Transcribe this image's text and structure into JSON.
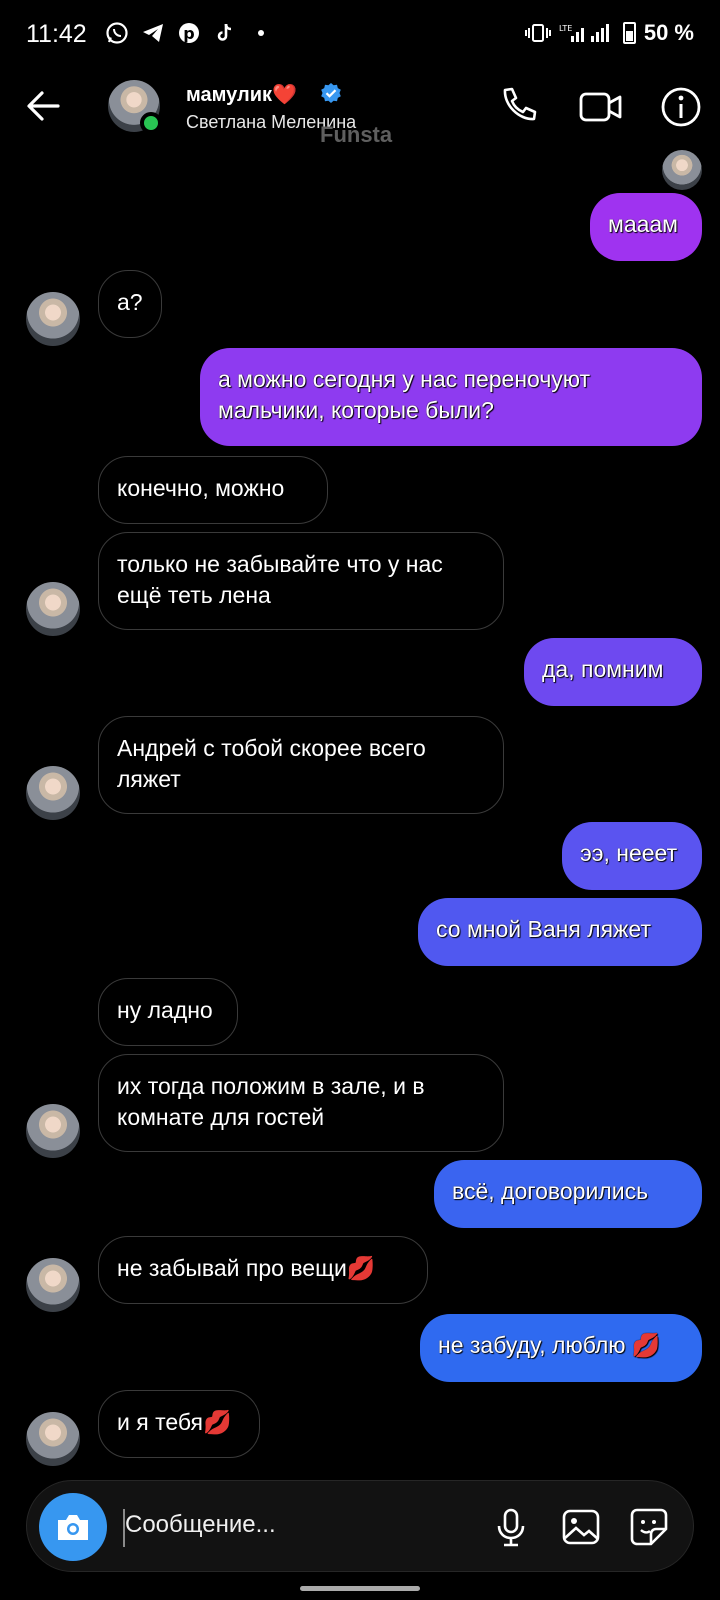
{
  "status_bar": {
    "time": "11:42",
    "battery": "50 %",
    "network": "LTE"
  },
  "header": {
    "contact_name": "мамулик❤️",
    "contact_subtitle": "Светлана Меленина",
    "watermark": "Funsta"
  },
  "messages": [
    {
      "dir": "out",
      "text": "мааам"
    },
    {
      "dir": "in",
      "text": "а?"
    },
    {
      "dir": "out",
      "text": "а можно сегодня у нас переночуют\nмальчики, которые  были?"
    },
    {
      "dir": "in",
      "text": "конечно, можно"
    },
    {
      "dir": "in",
      "text": "только не забывайте что у нас\nещё теть лена"
    },
    {
      "dir": "out",
      "text": "да, помним"
    },
    {
      "dir": "in",
      "text": "Андрей с тобой скорее всего\nляжет"
    },
    {
      "dir": "out",
      "text": "ээ, нееет"
    },
    {
      "dir": "out",
      "text": "со мной Ваня ляжет"
    },
    {
      "dir": "in",
      "text": "ну ладно"
    },
    {
      "dir": "in",
      "text": "их тогда положим в зале, и в\nкомнате для гостей"
    },
    {
      "dir": "out",
      "text": "всё, договорились"
    },
    {
      "dir": "in",
      "text": "не забывай про вещи💋"
    },
    {
      "dir": "out",
      "text": "не забуду, люблю 💋"
    },
    {
      "dir": "in",
      "text": "и я тебя💋"
    }
  ],
  "composer": {
    "placeholder": "Сообщение..."
  },
  "colors": {
    "bubble_gradient_top": "#a032f0",
    "bubble_gradient_mid": "#6b4cf0",
    "bubble_gradient_bottom": "#2f6af0",
    "online": "#29c553",
    "camera_button": "#3797f0",
    "verified": "#3797f0"
  },
  "icons": [
    "back-arrow-icon",
    "phone-icon",
    "video-call-icon",
    "info-icon",
    "camera-icon",
    "microphone-icon",
    "gallery-icon",
    "sticker-icon",
    "verified-badge-icon"
  ]
}
